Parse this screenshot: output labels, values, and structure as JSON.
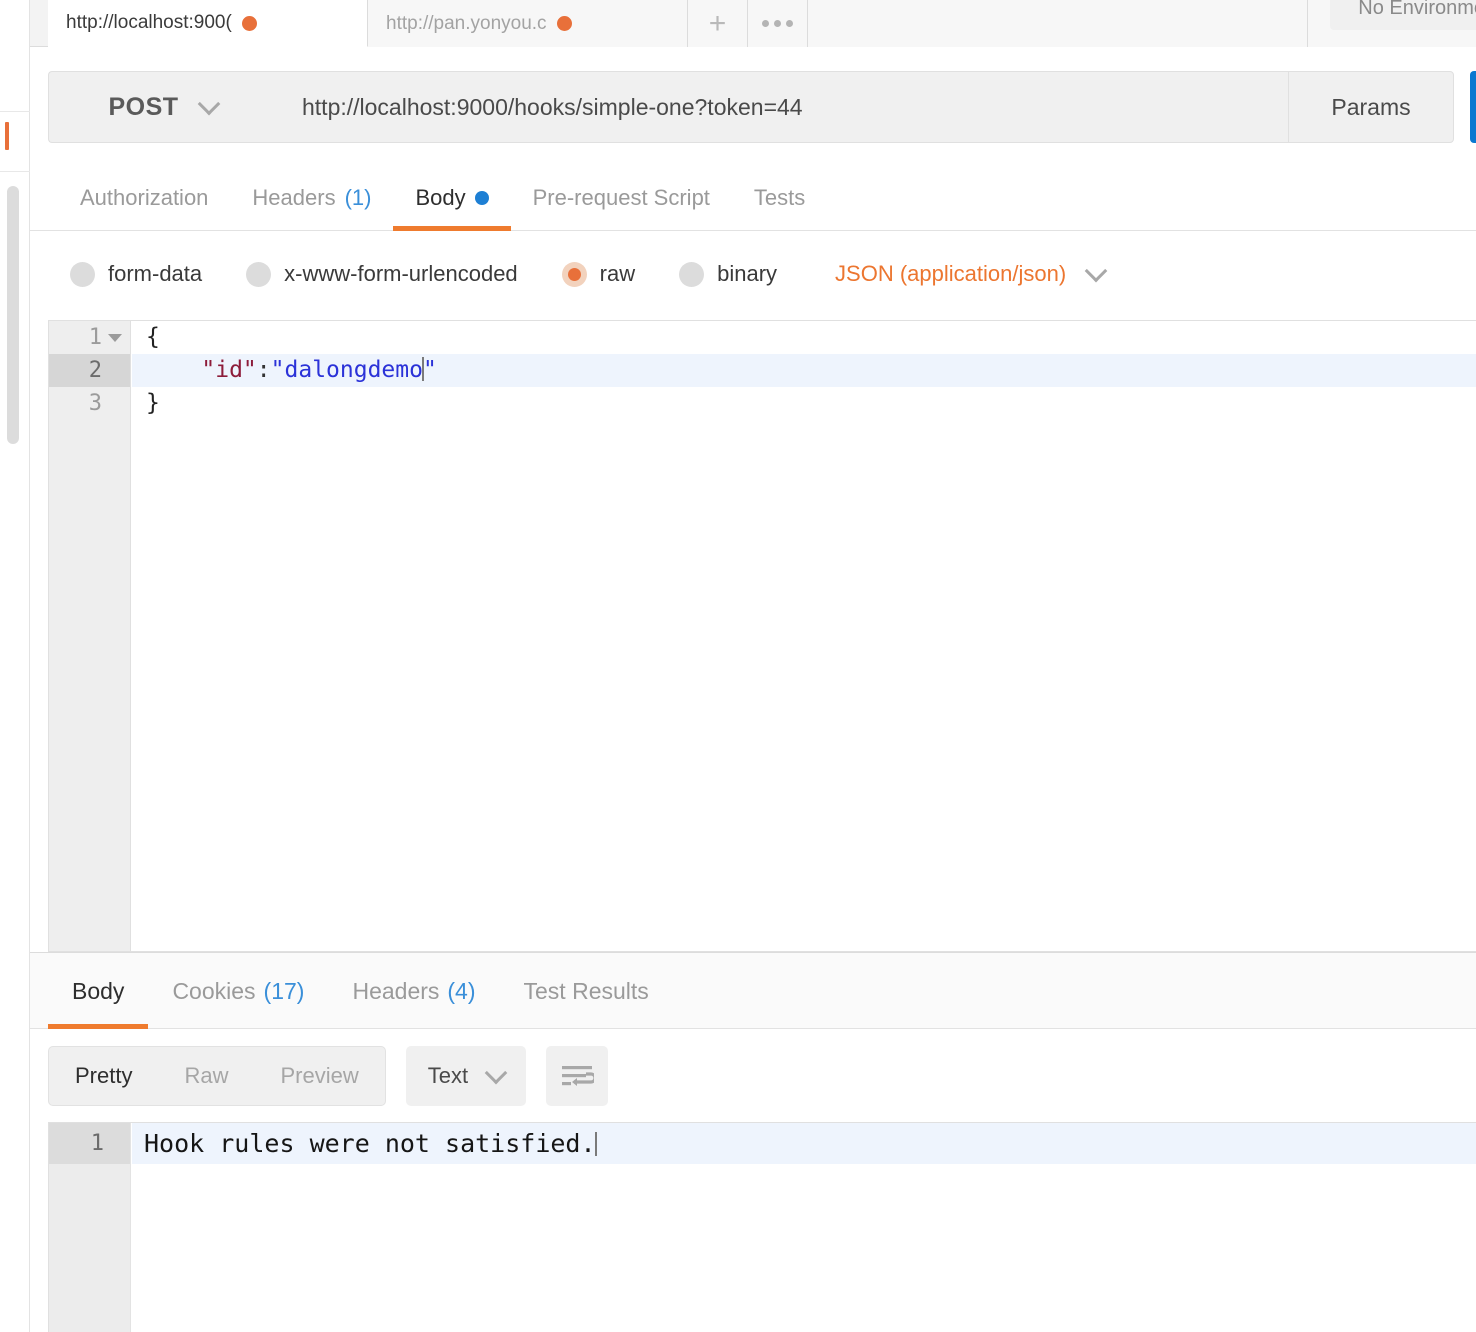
{
  "window": {
    "environment_label": "No Environment"
  },
  "request_tabs": [
    {
      "title": "http://localhost:900(",
      "unsaved": true,
      "active": true
    },
    {
      "title": "http://pan.yonyou.c",
      "unsaved": true,
      "active": false
    }
  ],
  "tab_actions": {
    "add_label": "+",
    "more_label": "•••"
  },
  "url_bar": {
    "method": "POST",
    "url": "http://localhost:9000/hooks/simple-one?token=44",
    "params_label": "Params",
    "send_label": ""
  },
  "request_tabs_row": [
    {
      "label": "Authorization",
      "count": "",
      "active": false
    },
    {
      "label": "Headers",
      "count": "(1)",
      "active": false
    },
    {
      "label": "Body",
      "count": "",
      "active": true,
      "has_dot": true
    },
    {
      "label": "Pre-request Script",
      "count": "",
      "active": false
    },
    {
      "label": "Tests",
      "count": "",
      "active": false
    }
  ],
  "body_types": [
    {
      "label": "form-data",
      "selected": false
    },
    {
      "label": "x-www-form-urlencoded",
      "selected": false
    },
    {
      "label": "raw",
      "selected": true
    },
    {
      "label": "binary",
      "selected": false
    }
  ],
  "content_type": {
    "label": "JSON (application/json)"
  },
  "request_body": {
    "lines": [
      {
        "number": "1",
        "foldable": true,
        "current": false,
        "text": "{"
      },
      {
        "number": "2",
        "foldable": false,
        "current": true,
        "text": "    \"id\":\"dalongdemo\""
      },
      {
        "number": "3",
        "foldable": false,
        "current": false,
        "text": "}"
      }
    ],
    "line1_text": "{",
    "line2_indent": "    ",
    "line2_key": "\"id\"",
    "line2_colon": ":",
    "line2_value_open": "\"",
    "line2_value": "dalongdemo",
    "line2_value_close": "\"",
    "line3_text": "}"
  },
  "response_tabs": [
    {
      "label": "Body",
      "count": "",
      "active": true
    },
    {
      "label": "Cookies",
      "count": "(17)",
      "active": false
    },
    {
      "label": "Headers",
      "count": "(4)",
      "active": false
    },
    {
      "label": "Test Results",
      "count": "",
      "active": false
    }
  ],
  "response_toolbar": {
    "view_modes": [
      {
        "label": "Pretty",
        "active": true
      },
      {
        "label": "Raw",
        "active": false
      },
      {
        "label": "Preview",
        "active": false
      }
    ],
    "format_label": "Text",
    "wrap_icon": "wrap-lines-icon"
  },
  "response_body": {
    "line_number": "1",
    "text": "Hook rules were not satisfied."
  },
  "colors": {
    "accent_orange": "#ef7b2e",
    "unsaved_dot": "#e8703a",
    "link_blue": "#3a8fd9",
    "body_dot_blue": "#1d7fd4",
    "send_blue": "#0b78d0",
    "content_type_orange": "#ec7630",
    "json_key": "#8d1c3a",
    "json_string": "#2b32d8",
    "active_line": "#eef4fd"
  }
}
